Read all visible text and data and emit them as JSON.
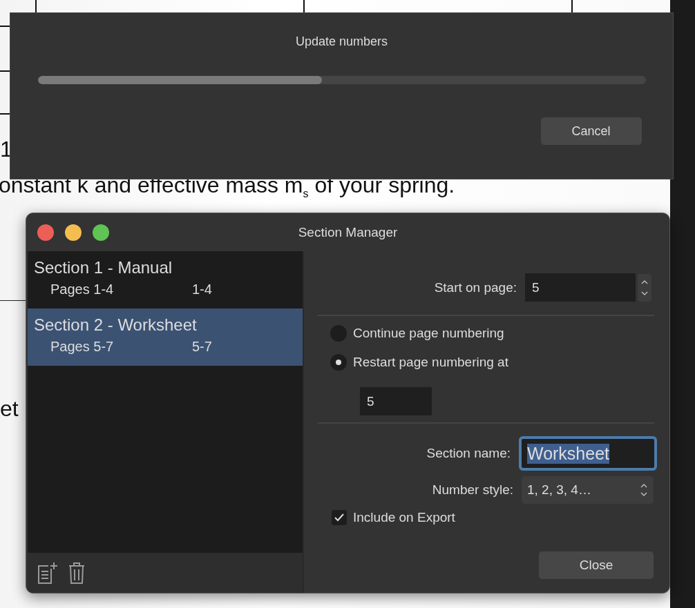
{
  "document": {
    "texts": [
      {
        "text": "1"
      },
      {
        "text": "onstant k and effective mass m$_{s}$ of your spring."
      },
      {
        "text": "et"
      }
    ]
  },
  "progress_dialog": {
    "title": "Update numbers",
    "level": 0.468,
    "buttons": [
      "Cancel"
    ]
  },
  "section_manager": {
    "title": "Section Manager",
    "sections": [
      {
        "name": "Section 1 - Manual",
        "pages": "Pages 1-4",
        "range": "1-4",
        "selected": false
      },
      {
        "name": "Section 2 - Worksheet",
        "pages": "Pages 5-7",
        "range": "5-7",
        "selected": true
      }
    ],
    "start_on_page": {
      "label": "Start on page:",
      "value": "5"
    },
    "numbering_options": [
      {
        "label": "Continue page numbering",
        "selected": false
      },
      {
        "label": "Restart page numbering at",
        "selected": true
      }
    ],
    "restart_at": {
      "value": "5"
    },
    "section_name": {
      "label": "Section name:",
      "value": "Worksheet",
      "focused": true
    },
    "number_style": {
      "label": "Number style:",
      "value": "1, 2, 3, 4…"
    },
    "include_on_export": {
      "label": "Include on Export",
      "checked": true
    },
    "buttons": [
      "Close"
    ]
  }
}
